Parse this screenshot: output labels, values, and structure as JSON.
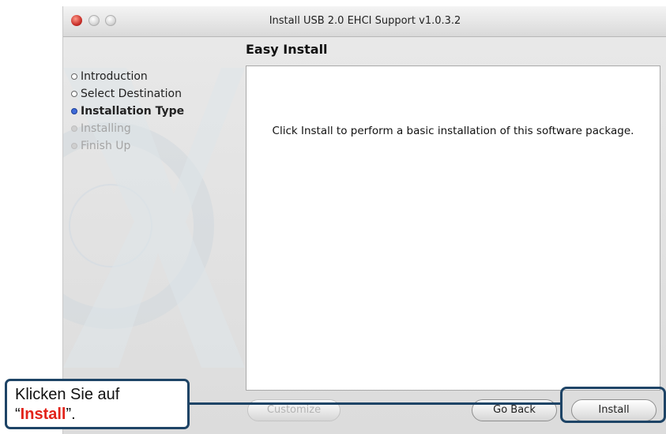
{
  "window": {
    "title": "Install USB 2.0 EHCI Support v1.0.3.2"
  },
  "sidebar": {
    "steps": [
      {
        "label": "Introduction",
        "state": "done"
      },
      {
        "label": "Select Destination",
        "state": "done"
      },
      {
        "label": "Installation Type",
        "state": "current"
      },
      {
        "label": "Installing",
        "state": "pending"
      },
      {
        "label": "Finish Up",
        "state": "pending"
      }
    ]
  },
  "main": {
    "title": "Easy Install",
    "message": "Click Install to perform a basic installation of this software package."
  },
  "buttons": {
    "customize": "Customize",
    "go_back": "Go Back",
    "install": "Install"
  },
  "callout": {
    "prefix": "Klicken Sie auf",
    "open_quote": "“",
    "highlight": "Install",
    "suffix": "”."
  },
  "colors": {
    "callout_border": "#1e4466",
    "callout_highlight": "#e2231a",
    "current_step_bullet": "#3f6bd8"
  }
}
